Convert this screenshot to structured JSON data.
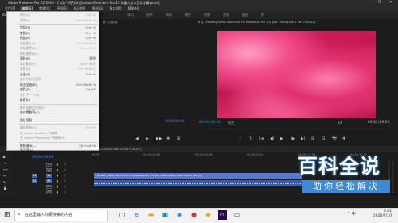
{
  "window": {
    "title": "Adobe Premiere Pro CC 2019 - C:\\用户\\PJPJ\\文档\\Adobe\\Premiere Pro\\13.0\\嵌入文本音频字幕.prproj"
  },
  "menubar": {
    "items": [
      "文件(F)",
      "编辑(E)",
      "剪辑(C)",
      "序列(S)",
      "标记(M)",
      "图形(G)",
      "窗口(W)",
      "帮助(H)"
    ],
    "active_index": 1
  },
  "workspaces": {
    "items": [
      "学习",
      "组件",
      "编辑",
      "颜色",
      "效果",
      "音频",
      "图形",
      "库"
    ],
    "selected_index": 2
  },
  "source": {
    "header": "源: (无剪辑)",
    "timecode": "00;00;00;00"
  },
  "program": {
    "header": "节目: [Mosaic] Samui Nanmeno no Sodalistas Poi - 01 [BD 1920x1080 x.264 FLACx2]",
    "timecode_left": "00;00;00;00",
    "fit": "适合",
    "quality": "1/4",
    "timecode_right": "00;22;49;20"
  },
  "controls": {
    "source": [
      "◀",
      "▶",
      "▶▶",
      "✚",
      "⊞"
    ],
    "program": [
      "{",
      "}",
      "|◀",
      "◀|",
      "▶",
      "|▶",
      "▶|",
      "⊞",
      "⊟",
      "📷",
      "✚"
    ]
  },
  "timeline": {
    "header": "[Mosaic] Samui Nanmeno no Sodalistas Poi - 01 [BD 1920x1080 x.264 FLACx2]",
    "timecode": "00;00;00;00",
    "ruler": [
      "00;00",
      "00;00;04;08",
      "00;00;08;16",
      "00;00;12;24",
      "00;00;17;04",
      "00;00;21;12"
    ],
    "tracks": [
      {
        "name": "V3",
        "src": "",
        "on": false
      },
      {
        "name": "V2",
        "src": "",
        "on": false
      },
      {
        "name": "V1",
        "src": "V1",
        "on": true
      },
      {
        "name": "A1",
        "src": "A1",
        "on": true
      },
      {
        "name": "A2",
        "src": "",
        "on": false
      },
      {
        "name": "A3",
        "src": "",
        "on": false
      }
    ],
    "video_clip": "[Mosaic] Samui Nanmeno no Sodalistas Poi - 01 [BD 1920x1080 x.264 FLACx2].mkv [V]"
  },
  "edit_menu": {
    "items": [
      {
        "label": "撤消(U)",
        "shortcut": "Ctrl+Z",
        "disabled": true
      },
      {
        "label": "重做(R)",
        "shortcut": "Ctrl+Shift+Z",
        "disabled": true
      },
      {
        "sep": true
      },
      {
        "label": "剪切(T)",
        "shortcut": "Ctrl+X",
        "disabled": false
      },
      {
        "label": "复制(Y)",
        "shortcut": "Ctrl+C",
        "disabled": false
      },
      {
        "label": "粘贴(P)",
        "shortcut": "Ctrl+V",
        "disabled": false
      },
      {
        "label": "粘贴插入(I)",
        "shortcut": "Ctrl+Shift+V",
        "disabled": true
      },
      {
        "label": "粘贴属性(B)...",
        "shortcut": "Ctrl+Alt+V",
        "disabled": true
      },
      {
        "label": "删除属性(R)...",
        "shortcut": "",
        "disabled": true
      },
      {
        "label": "清除(E)",
        "shortcut": "删除",
        "disabled": false
      },
      {
        "label": "波纹删除(T)",
        "shortcut": "Shift+删除",
        "disabled": true
      },
      {
        "label": "重复(C)",
        "shortcut": "Ctrl+Shift+/",
        "disabled": true
      },
      {
        "label": "全选(A)",
        "shortcut": "Ctrl+A",
        "disabled": false
      },
      {
        "label": "选择所有匹配项",
        "shortcut": "",
        "disabled": true
      },
      {
        "label": "取消全选(D)",
        "shortcut": "Ctrl+Shift+A",
        "disabled": false
      },
      {
        "label": "查找(F)...",
        "shortcut": "Ctrl+F",
        "disabled": false
      },
      {
        "label": "查找下一个(N)",
        "shortcut": "",
        "disabled": true
      },
      {
        "label": "标签(L)",
        "shortcut": "",
        "disabled": false,
        "submenu": true
      },
      {
        "sep": true
      },
      {
        "label": "移除未使用资源(R)",
        "shortcut": "",
        "disabled": true
      },
      {
        "label": "合并重复项(C)...",
        "shortcut": "",
        "disabled": false
      },
      {
        "sep": true
      },
      {
        "label": "团队项目",
        "shortcut": "",
        "disabled": false,
        "submenu": true
      },
      {
        "sep": true
      },
      {
        "label": "编辑原始(O)",
        "shortcut": "Ctrl+E",
        "disabled": true
      },
      {
        "label": "在 Adobe Audition 中编辑",
        "shortcut": "",
        "disabled": true,
        "submenu": true
      },
      {
        "label": "在 Adobe Photoshop 中编辑(H)",
        "shortcut": "",
        "disabled": true
      },
      {
        "sep": true
      },
      {
        "label": "快捷键(K)...",
        "shortcut": "Ctrl+Alt+K",
        "disabled": false
      },
      {
        "label": "首选项(N)",
        "shortcut": "",
        "disabled": false,
        "submenu": true
      }
    ]
  },
  "watermark": {
    "title": "百科全说",
    "subtitle": "助你轻松解决"
  },
  "taskbar": {
    "search_placeholder": "在这里输入你要搜索的内容",
    "time": "9:01",
    "date": "2020/7/10",
    "tray": "^ 中"
  },
  "colors": {
    "accent": "#3b8fd9",
    "clip_video": "#5b78c9",
    "clip_audio": "#3a5dab",
    "menu_bg": "#f0f0f0"
  }
}
